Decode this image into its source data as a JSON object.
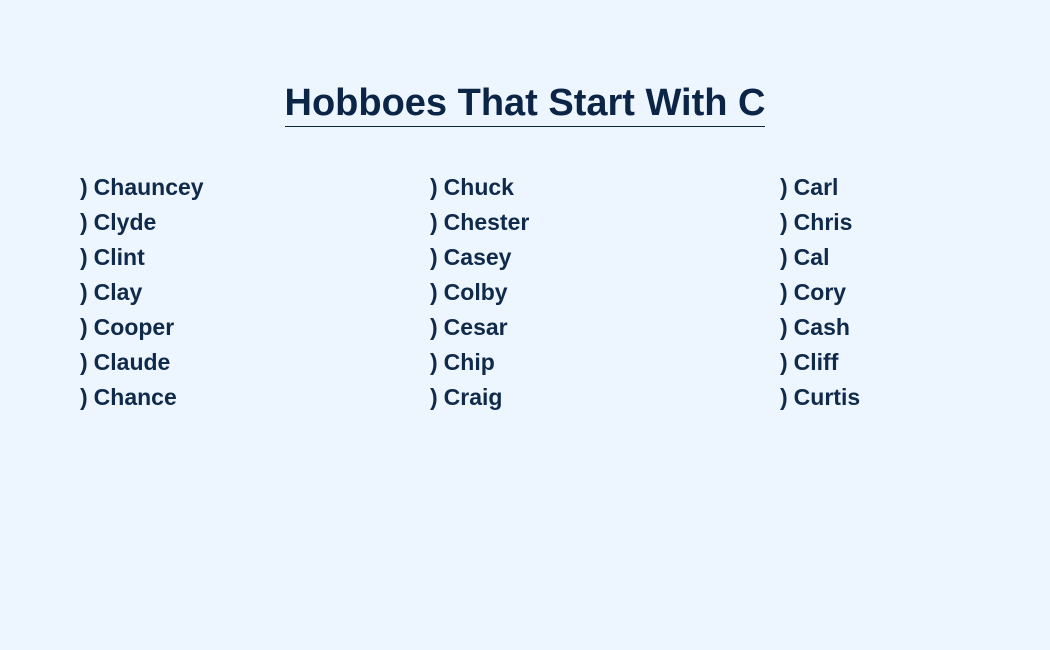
{
  "page": {
    "title": "Hobboes That Start With C",
    "bullet_marker": ")"
  },
  "columns": [
    {
      "items": [
        "Chauncey",
        "Clyde",
        "Clint",
        "Clay",
        "Cooper",
        "Claude",
        "Chance"
      ]
    },
    {
      "items": [
        "Chuck",
        "Chester",
        "Casey",
        "Colby",
        "Cesar",
        "Chip",
        "Craig"
      ]
    },
    {
      "items": [
        "Carl",
        "Chris",
        "Cal",
        "Cory",
        "Cash",
        "Cliff",
        "Curtis"
      ]
    }
  ],
  "colors": {
    "background": "#edf5fe",
    "text": "#0f2a4a",
    "title": "#0b2547"
  }
}
